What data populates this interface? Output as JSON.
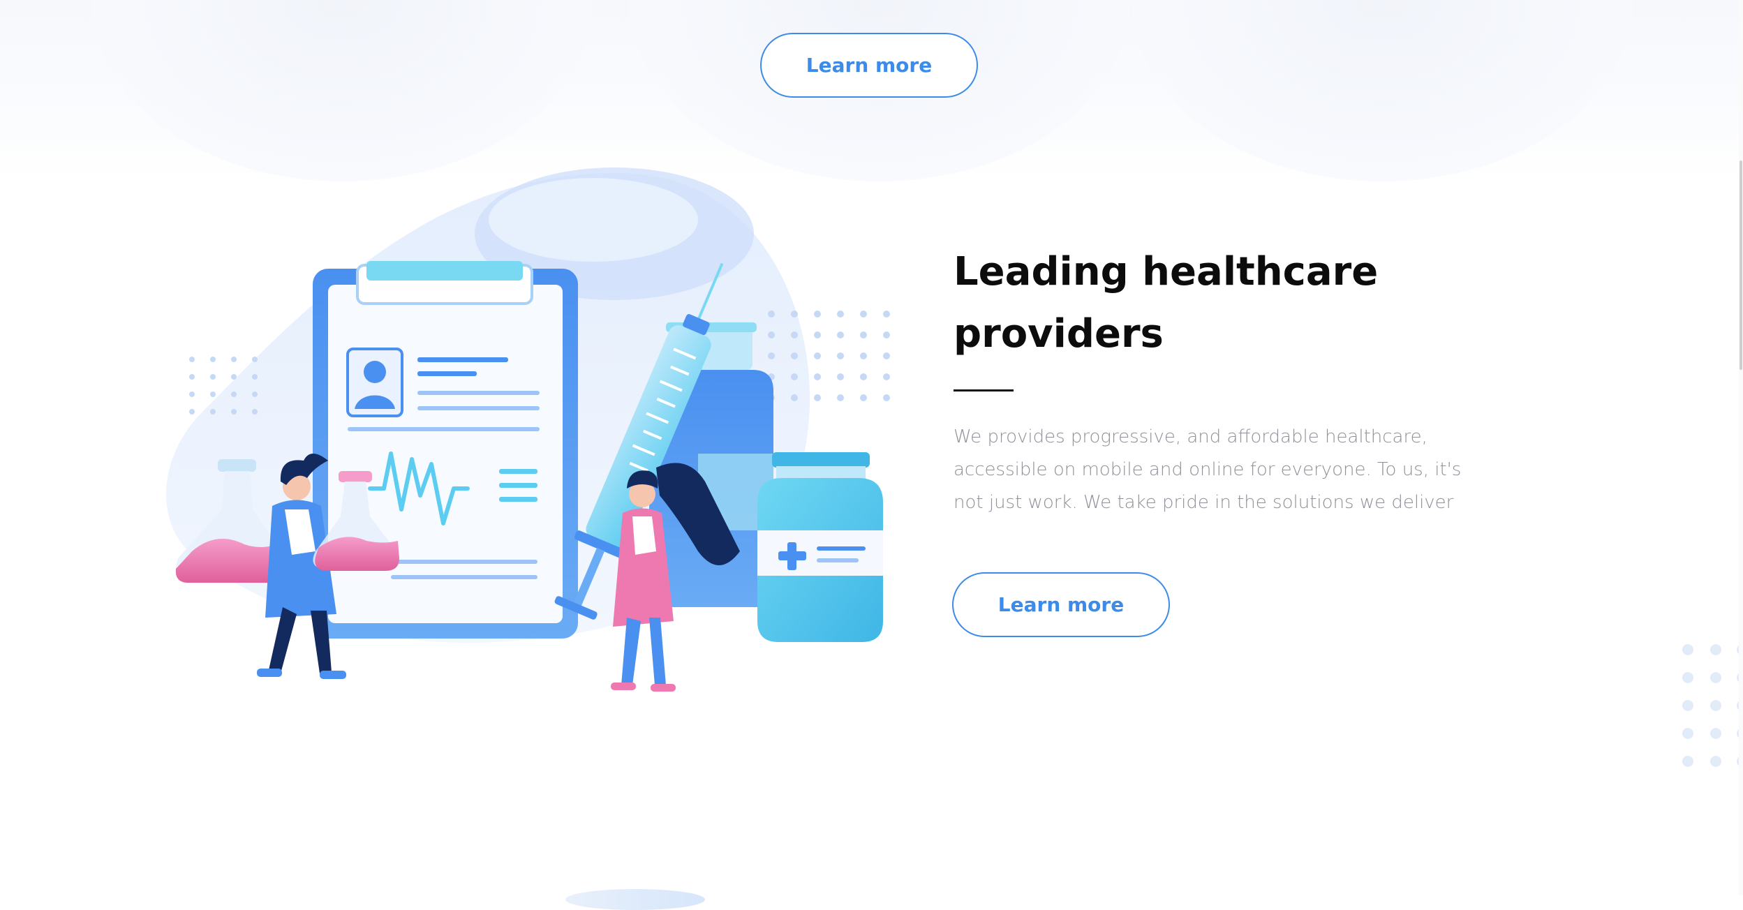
{
  "top_section": {
    "button_label": "Learn more"
  },
  "feature": {
    "heading_line1": "Leading healthcare",
    "heading_line2": "providers",
    "description": "We provides progressive, and affordable healthcare, accessible on mobile and online for everyone. To us, it's not just work. We take pride in the solutions we deliver",
    "button_label": "Learn more",
    "illustration": "medical-clipboard-illustration"
  },
  "colors": {
    "accent": "#3d8be9",
    "heading": "#0c0c0c",
    "body_text": "#8e9199",
    "illustration_blue": "#4a90f0",
    "illustration_cyan": "#5ccdf0",
    "illustration_pink": "#ee78b0",
    "background": "#ffffff"
  }
}
